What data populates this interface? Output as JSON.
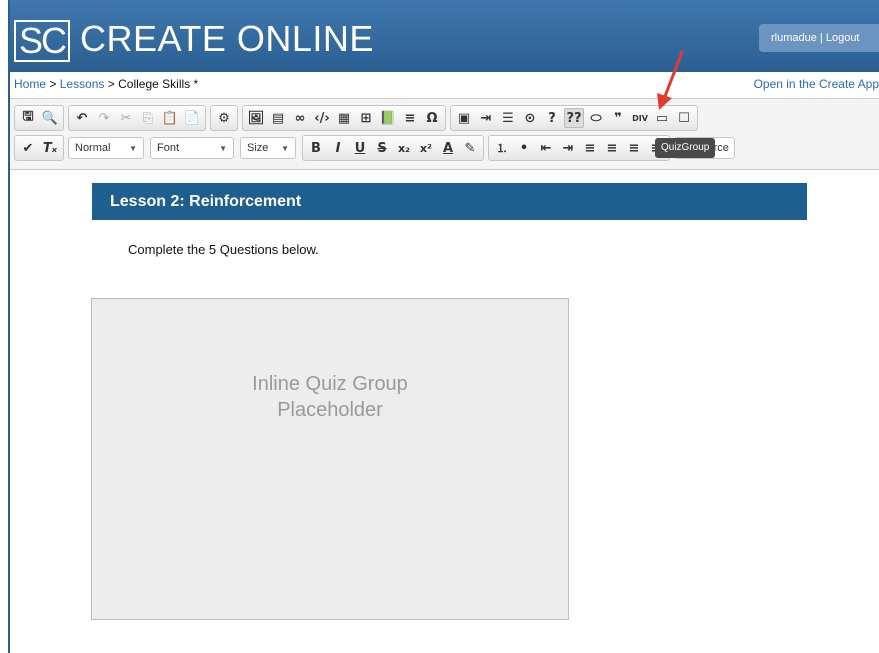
{
  "header": {
    "logo_text": "SC",
    "title": "CREATE ONLINE",
    "user": "rlumadue",
    "logout_label": "Logout"
  },
  "breadcrumb": {
    "home": "Home",
    "separator": ">",
    "lessons": "Lessons",
    "current": "College Skills *",
    "open_app": "Open in the Create App"
  },
  "toolbar": {
    "row1_icons": [
      "save-icon",
      "preview-icon",
      "undo-icon",
      "redo-icon",
      "cut-icon",
      "copy-icon",
      "paste-icon",
      "paste-text-icon",
      "settings-icon",
      "image-icon",
      "media-icon",
      "link-icon",
      "embed-icon",
      "widget-icon",
      "table-icon",
      "book-icon",
      "align-icon",
      "omega-icon",
      "template-icon",
      "list-indent-icon",
      "form-icon",
      "play-icon",
      "question-icon",
      "quizgroup-icon",
      "anchor-icon",
      "quote-icon",
      "div-icon",
      "panel-icon",
      "box-icon"
    ],
    "format_label": "Normal",
    "font_label": "Font",
    "size_label": "Size",
    "source_label": "Source",
    "tooltip": "QuizGroup",
    "glyphs": {
      "save": "🖫",
      "preview": "🔍",
      "undo": "↶",
      "redo": "↷",
      "cut": "✂",
      "copy": "⎘",
      "paste": "📋",
      "pastetext": "📄",
      "settings": "⚙",
      "image": "🖼",
      "media": "▤",
      "link": "∞",
      "embed": "‹/›",
      "widget": "▦",
      "table": "⊞",
      "book": "📗",
      "align": "≡",
      "omega": "Ω",
      "template": "▣",
      "indentlist": "⇥",
      "form": "☰",
      "play": "⊙",
      "question": "?",
      "quizgroup": "??",
      "anchor": "⬭",
      "quote": "❞",
      "div": "DIV",
      "panel": "▭",
      "box": "☐",
      "brush": "✔",
      "clear": "Tₓ",
      "bold": "B",
      "italic": "I",
      "underline": "U",
      "strike": "S",
      "sub": "x₂",
      "sup": "x²",
      "color": "A",
      "highlight": "✎",
      "ol": "⒈",
      "ul": "•",
      "outdent": "⇤",
      "indent": "⇥",
      "alignl": "≡",
      "alignc": "≡",
      "alignr": "≡",
      "justify": "≡"
    }
  },
  "content": {
    "lesson_title": "Lesson 2: Reinforcement",
    "intro": "Complete the 5 Questions below.",
    "placeholder_line1": "Inline Quiz Group",
    "placeholder_line2": "Placeholder"
  },
  "colors": {
    "header": "#2b5f93",
    "lesson_bar": "#1f5f8f",
    "link": "#2a6db3",
    "arrow": "#e23b2e"
  }
}
